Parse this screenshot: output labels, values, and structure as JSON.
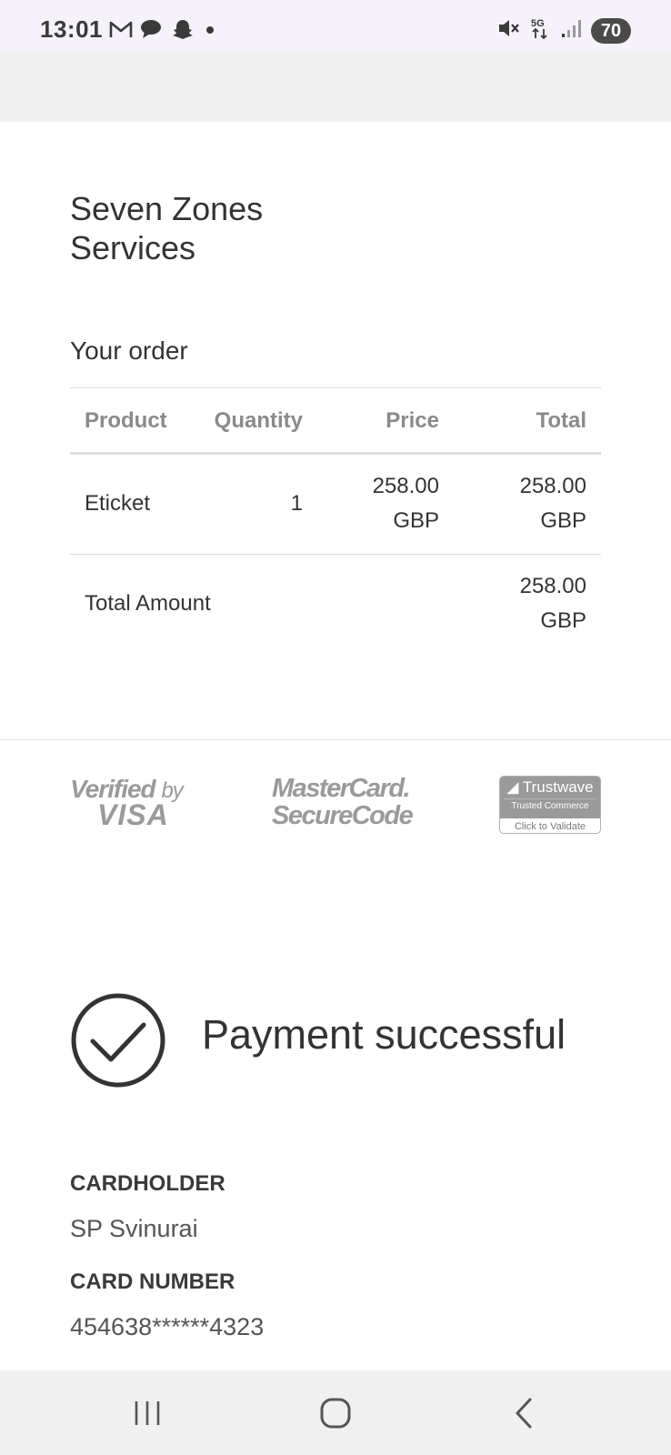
{
  "status_bar": {
    "time": "13:01",
    "battery": "70",
    "network": "5G",
    "left_icons": [
      "gmail-icon",
      "chat-icon",
      "snapchat-icon",
      "dot-icon"
    ],
    "right_icons": [
      "mute-icon",
      "5g-icon",
      "signal-icon",
      "battery-icon"
    ]
  },
  "merchant": {
    "name": "Seven Zones Services"
  },
  "order": {
    "heading": "Your order",
    "columns": [
      "Product",
      "Quantity",
      "Price",
      "Total"
    ],
    "items": [
      {
        "product": "Eticket",
        "quantity": "1",
        "price_amount": "258.00",
        "price_currency": "GBP",
        "total_amount": "258.00",
        "total_currency": "GBP"
      }
    ],
    "total_label": "Total Amount",
    "total_amount": "258.00",
    "total_currency": "GBP"
  },
  "security_logos": {
    "visa_line1": "Verified",
    "visa_by": "by",
    "visa_line2": "VISA",
    "mastercard_line1": "MasterCard.",
    "mastercard_line2": "SecureCode",
    "trustwave_brand": "Trustwave",
    "trustwave_sub": "Trusted Commerce",
    "trustwave_action": "Click to Validate"
  },
  "payment": {
    "status": "Payment successful",
    "cardholder_label": "CARDHOLDER",
    "cardholder_value": "SP Svinurai",
    "card_number_label": "CARD NUMBER",
    "card_number_value": "454638******4323"
  },
  "colors": {
    "status_bar_bg": "#f5f3f9",
    "band_bg": "#f0f0f0",
    "text": "#333333",
    "muted": "#8a8a8a"
  }
}
